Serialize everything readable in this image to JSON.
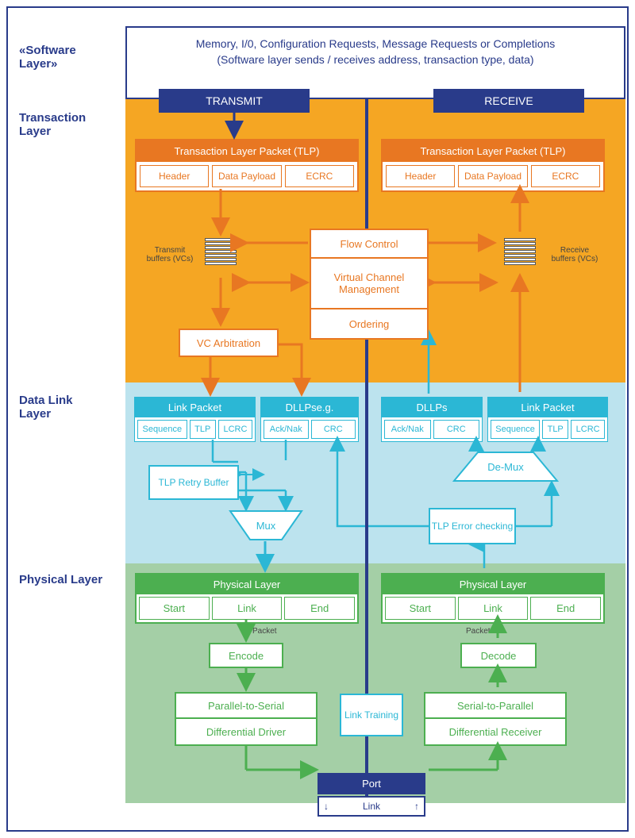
{
  "layer_labels": {
    "software": "«Software Layer»",
    "transaction": "Transaction Layer",
    "datalink": "Data Link Layer",
    "physical": "Physical Layer"
  },
  "software_box": {
    "line1": "Memory, I/0, Configuration Requests, Message Requests or Completions",
    "line2": "(Software layer sends / receives address, transaction type, data)"
  },
  "headers": {
    "transmit": "TRANSMIT",
    "receive": "RECEIVE"
  },
  "tlp": {
    "title": "Transaction Layer Packet (TLP)",
    "cells": [
      "Header",
      "Data Payload",
      "ECRC"
    ]
  },
  "buffers": {
    "transmit_label": "Transmit buffers (VCs)",
    "receive_label": "Receive buffers (VCs)"
  },
  "vc_arbitration": "VC Arbitration",
  "middle_boxes": [
    "Flow Control",
    "Virtual Channel Management",
    "Ordering"
  ],
  "link_packet": {
    "title": "Link Packet",
    "cells": [
      "Sequence",
      "TLP",
      "LCRC"
    ]
  },
  "dllp_eg": {
    "title": "DLLPse.g.",
    "cells": [
      "Ack/Nak",
      "CRC"
    ]
  },
  "dllp": {
    "title": "DLLPs",
    "cells": [
      "Ack/Nak",
      "CRC"
    ]
  },
  "retry_buffer": "TLP Retry Buffer",
  "mux": "Mux",
  "demux": "De-Mux",
  "tlp_error": "TLP Error checking",
  "physical": {
    "title": "Physical Layer",
    "cells": [
      "Start",
      "Link",
      "End"
    ]
  },
  "packet_label": "Packet",
  "encode": "Encode",
  "decode": "Decode",
  "p2s": "Parallel-to-Serial",
  "diff_driver": "Differential Driver",
  "s2p": "Serial-to-Parallel",
  "diff_receiver": "Differential Receiver",
  "link_training": "Link Training",
  "port": "Port",
  "link": "Link"
}
